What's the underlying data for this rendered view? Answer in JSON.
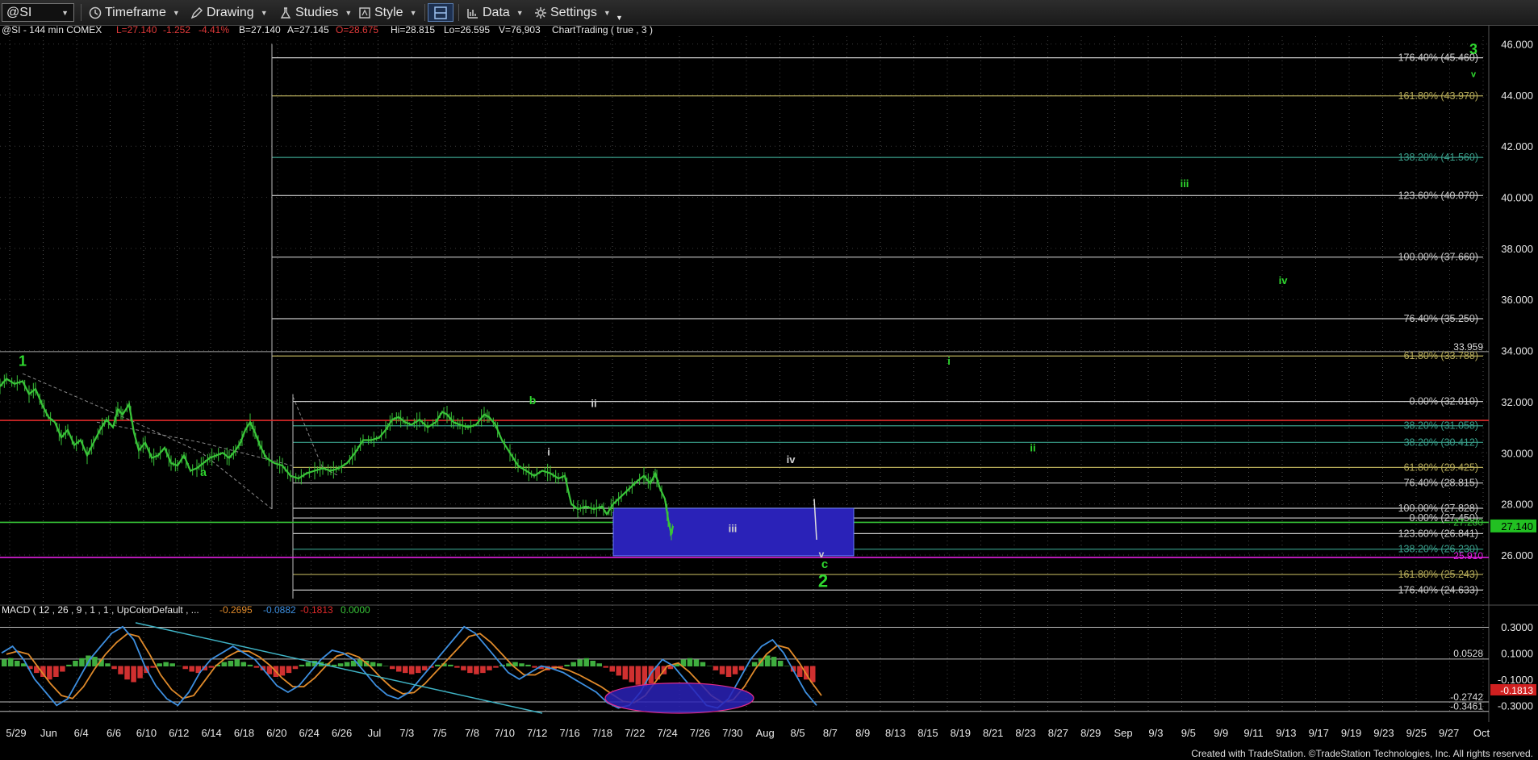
{
  "toolbar": {
    "symbol": "@SI",
    "timeframe": "Timeframe",
    "drawing": "Drawing",
    "studies": "Studies",
    "style": "Style",
    "data": "Data",
    "settings": "Settings"
  },
  "header": {
    "symbol_info": "@SI - 144 min  COMEX",
    "last": "L=27.140",
    "change": "-1.252",
    "change_pct": "-4.41%",
    "bid": "B=27.140",
    "ask": "A=27.145",
    "open": "O=28.675",
    "high": "Hi=28.815",
    "low": "Lo=26.595",
    "volume": "V=76,903",
    "study": "ChartTrading ( true , 3 )"
  },
  "colors": {
    "up": "#39c439",
    "red": "#e02a2a",
    "magenta": "#e020e0",
    "green_line": "#36c236",
    "box_fill": "#2a22b8",
    "wave": "#2fd82f",
    "macd_line": "#3d8fe0",
    "signal_line": "#e08a2a"
  },
  "chart_data": {
    "type": "line",
    "title": "",
    "price_axis": {
      "ticks": [
        "46.000",
        "44.000",
        "42.000",
        "40.000",
        "38.000",
        "36.000",
        "34.000",
        "32.000",
        "30.000",
        "28.000",
        "26.000"
      ],
      "ylim": [
        24.2,
        46.3
      ],
      "last_price": "27.140",
      "extra_labels": [
        "33.959",
        "27.280",
        "25.910"
      ]
    },
    "x_axis": {
      "labels": [
        "5/29",
        "Jun",
        "6/4",
        "6/6",
        "6/10",
        "6/12",
        "6/14",
        "6/18",
        "6/20",
        "6/24",
        "6/26",
        "Jul",
        "7/3",
        "7/5",
        "7/8",
        "7/10",
        "7/12",
        "7/16",
        "7/18",
        "7/22",
        "7/24",
        "7/26",
        "7/30",
        "Aug",
        "8/5",
        "8/7",
        "8/9",
        "8/13",
        "8/15",
        "8/19",
        "8/21",
        "8/23",
        "8/27",
        "8/29",
        "Sep",
        "9/3",
        "9/5",
        "9/9",
        "9/11",
        "9/13",
        "9/17",
        "9/19",
        "9/23",
        "9/25",
        "9/27",
        "Oct"
      ]
    },
    "price_series": [
      [
        0,
        32.6
      ],
      [
        8,
        32.9
      ],
      [
        18,
        32.7
      ],
      [
        28,
        32.8
      ],
      [
        36,
        32.3
      ],
      [
        44,
        32.5
      ],
      [
        52,
        31.9
      ],
      [
        60,
        31.4
      ],
      [
        68,
        31.2
      ],
      [
        76,
        30.6
      ],
      [
        84,
        30.9
      ],
      [
        92,
        30.3
      ],
      [
        100,
        30.5
      ],
      [
        108,
        29.9
      ],
      [
        116,
        30.4
      ],
      [
        124,
        30.9
      ],
      [
        132,
        31.3
      ],
      [
        140,
        31.0
      ],
      [
        146,
        31.7
      ],
      [
        152,
        31.5
      ],
      [
        160,
        31.9
      ],
      [
        166,
        30.8
      ],
      [
        172,
        30.1
      ],
      [
        180,
        30.4
      ],
      [
        188,
        29.8
      ],
      [
        196,
        29.9
      ],
      [
        204,
        30.2
      ],
      [
        212,
        29.6
      ],
      [
        220,
        29.5
      ],
      [
        228,
        29.9
      ],
      [
        236,
        29.3
      ],
      [
        244,
        29.4
      ],
      [
        252,
        29.6
      ],
      [
        260,
        29.8
      ],
      [
        268,
        29.9
      ],
      [
        276,
        30.0
      ],
      [
        284,
        29.8
      ],
      [
        292,
        30.1
      ],
      [
        298,
        30.4
      ],
      [
        304,
        30.9
      ],
      [
        310,
        31.2
      ],
      [
        316,
        30.8
      ],
      [
        322,
        30.3
      ],
      [
        330,
        29.8
      ],
      [
        340,
        29.6
      ],
      [
        350,
        29.5
      ],
      [
        360,
        29.1
      ],
      [
        370,
        29.0
      ],
      [
        380,
        29.2
      ],
      [
        390,
        29.3
      ],
      [
        400,
        29.4
      ],
      [
        410,
        29.3
      ],
      [
        420,
        29.4
      ],
      [
        430,
        29.6
      ],
      [
        440,
        30.0
      ],
      [
        450,
        30.5
      ],
      [
        460,
        30.5
      ],
      [
        470,
        30.6
      ],
      [
        478,
        30.9
      ],
      [
        486,
        31.3
      ],
      [
        494,
        31.4
      ],
      [
        502,
        31.2
      ],
      [
        510,
        31.1
      ],
      [
        520,
        31.3
      ],
      [
        530,
        31.0
      ],
      [
        540,
        31.2
      ],
      [
        548,
        31.6
      ],
      [
        554,
        31.5
      ],
      [
        562,
        31.2
      ],
      [
        570,
        31.1
      ],
      [
        580,
        31.0
      ],
      [
        590,
        31.1
      ],
      [
        600,
        31.5
      ],
      [
        606,
        31.4
      ],
      [
        614,
        31.1
      ],
      [
        622,
        30.5
      ],
      [
        632,
        30.0
      ],
      [
        642,
        29.5
      ],
      [
        652,
        29.3
      ],
      [
        662,
        29.1
      ],
      [
        672,
        29.3
      ],
      [
        682,
        29.2
      ],
      [
        692,
        29.0
      ],
      [
        700,
        29.1
      ],
      [
        708,
        28.0
      ],
      [
        716,
        27.8
      ],
      [
        726,
        27.9
      ],
      [
        736,
        27.8
      ],
      [
        746,
        27.9
      ],
      [
        752,
        27.6
      ],
      [
        760,
        28.0
      ],
      [
        770,
        28.3
      ],
      [
        780,
        28.6
      ],
      [
        790,
        28.9
      ],
      [
        798,
        29.1
      ],
      [
        806,
        28.8
      ],
      [
        812,
        29.2
      ],
      [
        818,
        28.6
      ],
      [
        824,
        28.2
      ],
      [
        828,
        27.4
      ],
      [
        832,
        26.8
      ],
      [
        834,
        27.14
      ]
    ],
    "fib_levels": [
      {
        "label": "176.40% (45.460)",
        "value": 45.46,
        "color": "#cfcfcf"
      },
      {
        "label": "161.80% (43.970)",
        "value": 43.97,
        "color": "#b8ad5a"
      },
      {
        "label": "138.20% (41.560)",
        "value": 41.56,
        "color": "#3aa08c"
      },
      {
        "label": "123.60% (40.070)",
        "value": 40.07,
        "color": "#c8c8c8"
      },
      {
        "label": "100.00% (37.660)",
        "value": 37.66,
        "color": "#c8c8c8"
      },
      {
        "label": "76.40% (35.250)",
        "value": 35.25,
        "color": "#c8c8c8"
      },
      {
        "label": "61.80% (33.788)",
        "value": 33.79,
        "color": "#b8ad5a"
      },
      {
        "label": "0.00% (32.010)",
        "value": 32.01,
        "color": "#c8c8c8"
      },
      {
        "label": "38.20% (31.058)",
        "value": 31.06,
        "color": "#3aa08c"
      },
      {
        "label": "38.20% (30.412)",
        "value": 30.41,
        "color": "#3aa08c"
      },
      {
        "label": "61.80% (29.425)",
        "value": 29.43,
        "color": "#b8ad5a"
      },
      {
        "label": "76.40% (28.815)",
        "value": 28.82,
        "color": "#c8c8c8"
      },
      {
        "label": "100.00% (27.828)",
        "value": 27.83,
        "color": "#c8c8c8"
      },
      {
        "label": "0.00% (27.450)",
        "value": 27.45,
        "color": "#c8c8c8"
      },
      {
        "label": "123.60% (26.841)",
        "value": 26.84,
        "color": "#c8c8c8"
      },
      {
        "label": "138.20% (26.230)",
        "value": 26.23,
        "color": "#3aa08c"
      },
      {
        "label": "161.80% (25.243)",
        "value": 25.24,
        "color": "#b8ad5a"
      },
      {
        "label": "176.40% (24.633)",
        "value": 24.63,
        "color": "#c8c8c8"
      }
    ],
    "horizontal_lines": [
      {
        "value": 33.959,
        "color": "#a0a0a0"
      },
      {
        "value": 31.27,
        "color": "#e02a2a"
      },
      {
        "value": 27.28,
        "color": "#36c236"
      },
      {
        "value": 25.91,
        "color": "#e020e0"
      }
    ],
    "wave_labels": [
      {
        "text": "1",
        "i": 28,
        "value": 33.4,
        "size": 18,
        "color": "#2fd82f"
      },
      {
        "text": "a",
        "i": 252,
        "value": 29.1,
        "size": 14,
        "color": "#2fd82f"
      },
      {
        "text": "b",
        "i": 660,
        "value": 31.9,
        "size": 14,
        "color": "#2fd82f"
      },
      {
        "text": "ii",
        "i": 736,
        "value": 31.8,
        "size": 13,
        "color": "#d0d0d0"
      },
      {
        "text": "i",
        "i": 680,
        "value": 29.9,
        "size": 13,
        "color": "#d0d0d0"
      },
      {
        "text": "iii",
        "i": 908,
        "value": 26.9,
        "size": 13,
        "color": "#d0d0d0"
      },
      {
        "text": "iv",
        "i": 980,
        "value": 29.6,
        "size": 13,
        "color": "#d0d0d0"
      },
      {
        "text": "v",
        "i": 1018,
        "value": 25.9,
        "size": 12,
        "color": "#d0d0d0"
      },
      {
        "text": "c",
        "i": 1022,
        "value": 25.5,
        "size": 15,
        "color": "#2fd82f"
      },
      {
        "text": "2",
        "i": 1020,
        "value": 24.75,
        "size": 22,
        "color": "#2fd82f"
      },
      {
        "text": "i",
        "i": 1176,
        "value": 33.45,
        "size": 13,
        "color": "#2fd82f"
      },
      {
        "text": "ii",
        "i": 1280,
        "value": 30.05,
        "size": 13,
        "color": "#2fd82f"
      },
      {
        "text": "iii",
        "i": 1468,
        "value": 40.4,
        "size": 13,
        "color": "#2fd82f"
      },
      {
        "text": "iv",
        "i": 1590,
        "value": 36.6,
        "size": 13,
        "color": "#2fd82f"
      },
      {
        "text": "3",
        "i": 1826,
        "value": 45.6,
        "size": 18,
        "color": "#2fd82f"
      },
      {
        "text": "v",
        "i": 1826,
        "value": 44.7,
        "size": 11,
        "color": "#2fd82f"
      }
    ],
    "macd": {
      "label": "MACD ( 12 , 26 , 9 , 1 , 1 , UpColorDefault , ...",
      "values": [
        "-0.2695",
        "-0.0882",
        "-0.1813",
        "0.0000"
      ],
      "axis_ticks": [
        "0.3000",
        "0.1000",
        "-0.1000",
        "-0.3000"
      ],
      "axis_labels": [
        "0.0528",
        "-0.1813",
        "-0.2742",
        "-0.3461"
      ],
      "ylim": [
        -0.36,
        0.36
      ],
      "levels": [
        0.2955,
        0.0528,
        -0.2742,
        -0.3461
      ],
      "hist": [
        0.05,
        0.06,
        0.04,
        0.02,
        -0.02,
        -0.05,
        -0.08,
        -0.1,
        -0.08,
        -0.04,
        0.01,
        0.04,
        0.06,
        0.08,
        0.07,
        0.05,
        0.02,
        -0.02,
        -0.06,
        -0.1,
        -0.12,
        -0.09,
        -0.05,
        -0.01,
        0.02,
        0.03,
        0.02,
        0.0,
        -0.02,
        -0.04,
        -0.05,
        -0.03,
        -0.01,
        0.01,
        0.03,
        0.04,
        0.05,
        0.03,
        0.01,
        -0.01,
        -0.03,
        -0.06,
        -0.08,
        -0.07,
        -0.05,
        -0.02,
        0.01,
        0.03,
        0.04,
        0.03,
        0.02,
        0.01,
        0.02,
        0.03,
        0.04,
        0.05,
        0.04,
        0.03,
        0.02,
        0.0,
        -0.02,
        -0.04,
        -0.05,
        -0.06,
        -0.05,
        -0.03,
        -0.01,
        0.01,
        0.02,
        0.01,
        -0.01,
        -0.03,
        -0.05,
        -0.06,
        -0.05,
        -0.03,
        -0.01,
        0.01,
        0.02,
        0.03,
        0.02,
        0.01,
        -0.01,
        -0.02,
        -0.03,
        -0.02,
        -0.01,
        0.01,
        0.03,
        0.05,
        0.06,
        0.04,
        0.02,
        -0.01,
        -0.04,
        -0.07,
        -0.1,
        -0.12,
        -0.14,
        -0.15,
        -0.13,
        -0.1,
        -0.06,
        -0.02,
        0.02,
        0.05,
        0.06,
        0.05,
        0.03,
        0.0,
        -0.03,
        -0.06,
        -0.08,
        -0.06,
        -0.03,
        0.0,
        0.03,
        0.06,
        0.08,
        0.07,
        0.04,
        0.0,
        -0.04,
        -0.08,
        -0.1,
        -0.12
      ],
      "macd_line": [
        0.1,
        0.15,
        0.05,
        -0.1,
        -0.2,
        -0.3,
        -0.25,
        -0.1,
        0.05,
        0.15,
        0.25,
        0.3,
        0.2,
        0.0,
        -0.15,
        -0.25,
        -0.3,
        -0.2,
        -0.05,
        0.05,
        0.1,
        0.15,
        0.1,
        0.05,
        -0.05,
        -0.15,
        -0.2,
        -0.15,
        -0.05,
        0.05,
        0.12,
        0.1,
        0.05,
        -0.05,
        -0.15,
        -0.22,
        -0.25,
        -0.2,
        -0.1,
        0.0,
        0.1,
        0.2,
        0.3,
        0.25,
        0.15,
        0.05,
        -0.05,
        -0.1,
        -0.05,
        0.0,
        -0.02,
        -0.05,
        -0.1,
        -0.15,
        -0.2,
        -0.28,
        -0.32,
        -0.3,
        -0.2,
        -0.05,
        0.05,
        0.0,
        -0.1,
        -0.2,
        -0.3,
        -0.32,
        -0.25,
        -0.1,
        0.05,
        0.15,
        0.2,
        0.1,
        -0.05,
        -0.2,
        -0.3
      ]
    },
    "price_box": {
      "from_i": 760,
      "to_i": 1058,
      "top": 27.83,
      "bottom": 25.97
    },
    "macd_ellipse": {
      "cx_i": 842,
      "rx": 92,
      "cy": -0.245,
      "ry": 0.115
    }
  },
  "footer": "Created with TradeStation. ©TradeStation Technologies, Inc. All rights reserved."
}
